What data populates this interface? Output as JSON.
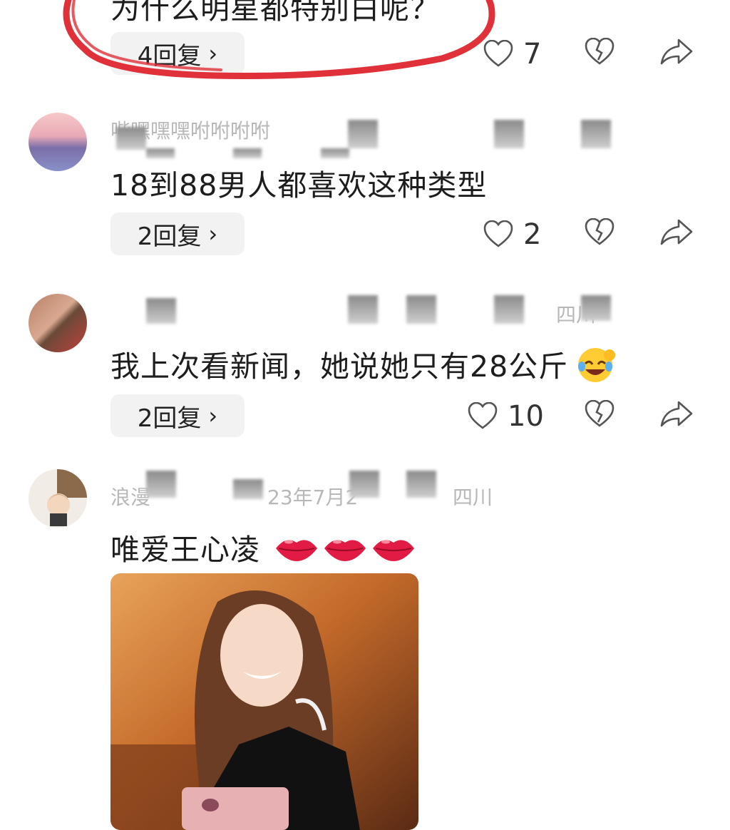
{
  "comments": [
    {
      "text": "为什么明星都特别白呢？",
      "replies_label": "4回复",
      "likes": "7"
    },
    {
      "username": "哔嘿嘿嘿咐咐咐咐",
      "text": "18到88男人都喜欢这种类型",
      "replies_label": "2回复",
      "likes": "2"
    },
    {
      "username": "",
      "location": "四川",
      "text": "我上次看新闻，她说她只有28公斤",
      "replies_label": "2回复",
      "likes": "10"
    },
    {
      "username": "浪漫",
      "date": "23年7月2",
      "location": "四川",
      "text": "唯爱王心凌"
    }
  ],
  "icons": {
    "like": "heart-outline-icon",
    "dislike": "broken-heart-icon",
    "share": "share-arrow-icon",
    "chevron": "chevron-right-icon",
    "emoji_laugh": "rofl-emoji",
    "emoji_lips": "kiss-lips-emoji"
  },
  "colors": {
    "annotation": "#e0303a",
    "reply_bg": "#f2f2f2",
    "meta_text": "#b8b8b8"
  }
}
